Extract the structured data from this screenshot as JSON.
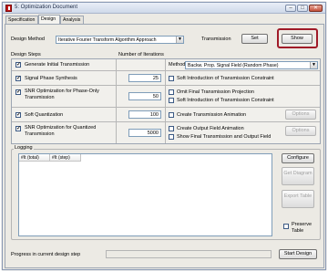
{
  "window": {
    "title": "5: Optimization Document",
    "controls": {
      "minimize": "–",
      "maximize": "□",
      "close": "✕"
    }
  },
  "tabs": [
    {
      "label": "Specification",
      "active": false
    },
    {
      "label": "Design",
      "active": true
    },
    {
      "label": "Analysis",
      "active": false
    }
  ],
  "design_method": {
    "label": "Design Method",
    "selected": "Iterative Fourier Transform Algorithm Approach"
  },
  "transmission": {
    "label": "Transmission",
    "set_label": "Set",
    "show_label": "Show"
  },
  "steps": {
    "header_steps": "Design Steps",
    "header_iterations": "Number of Iterations",
    "items": [
      {
        "label": "Generate Initial Transmission",
        "checked": true,
        "iterations": ""
      },
      {
        "label": "Signal Phase Synthesis",
        "checked": true,
        "iterations": "25"
      },
      {
        "label": "SNR Optimization for Phase-Only Transmission",
        "checked": true,
        "iterations": "50"
      },
      {
        "label": "Soft Quantization",
        "checked": true,
        "iterations": "100"
      },
      {
        "label": "SNR Optimization for Quantized Transmission",
        "checked": true,
        "iterations": "5000"
      }
    ]
  },
  "method": {
    "label": "Method",
    "selected": "Backw. Prop. Signal Field (Random Phase)"
  },
  "options": [
    {
      "label": "Soft Introduction of Transmission Constraint",
      "checked": false
    },
    {
      "label": "Omit Final Transmission Projection",
      "checked": false
    },
    {
      "label": "Soft Introduction of Transmission Constraint",
      "checked": false
    },
    {
      "label": "Create Transmission Animation",
      "checked": false
    },
    {
      "label": "Create Output Field Animation",
      "checked": false
    },
    {
      "label": "Show Final Transmission and Output Field",
      "checked": false
    }
  ],
  "options_button_label": "Options",
  "logging": {
    "label": "Logging",
    "columns": [
      "#It (total)",
      "#It (step)"
    ],
    "configure_label": "Configure",
    "get_diagram_label": "Get Diagram",
    "export_table_label": "Export Table",
    "preserve_table_label": "Preserve Table",
    "preserve_checked": false
  },
  "progress": {
    "label": "Progress in current design step",
    "value": 0
  },
  "start_design_label": "Start Design",
  "colors": {
    "highlight": "#a01a28",
    "progress_fill": "#3fb24a"
  }
}
